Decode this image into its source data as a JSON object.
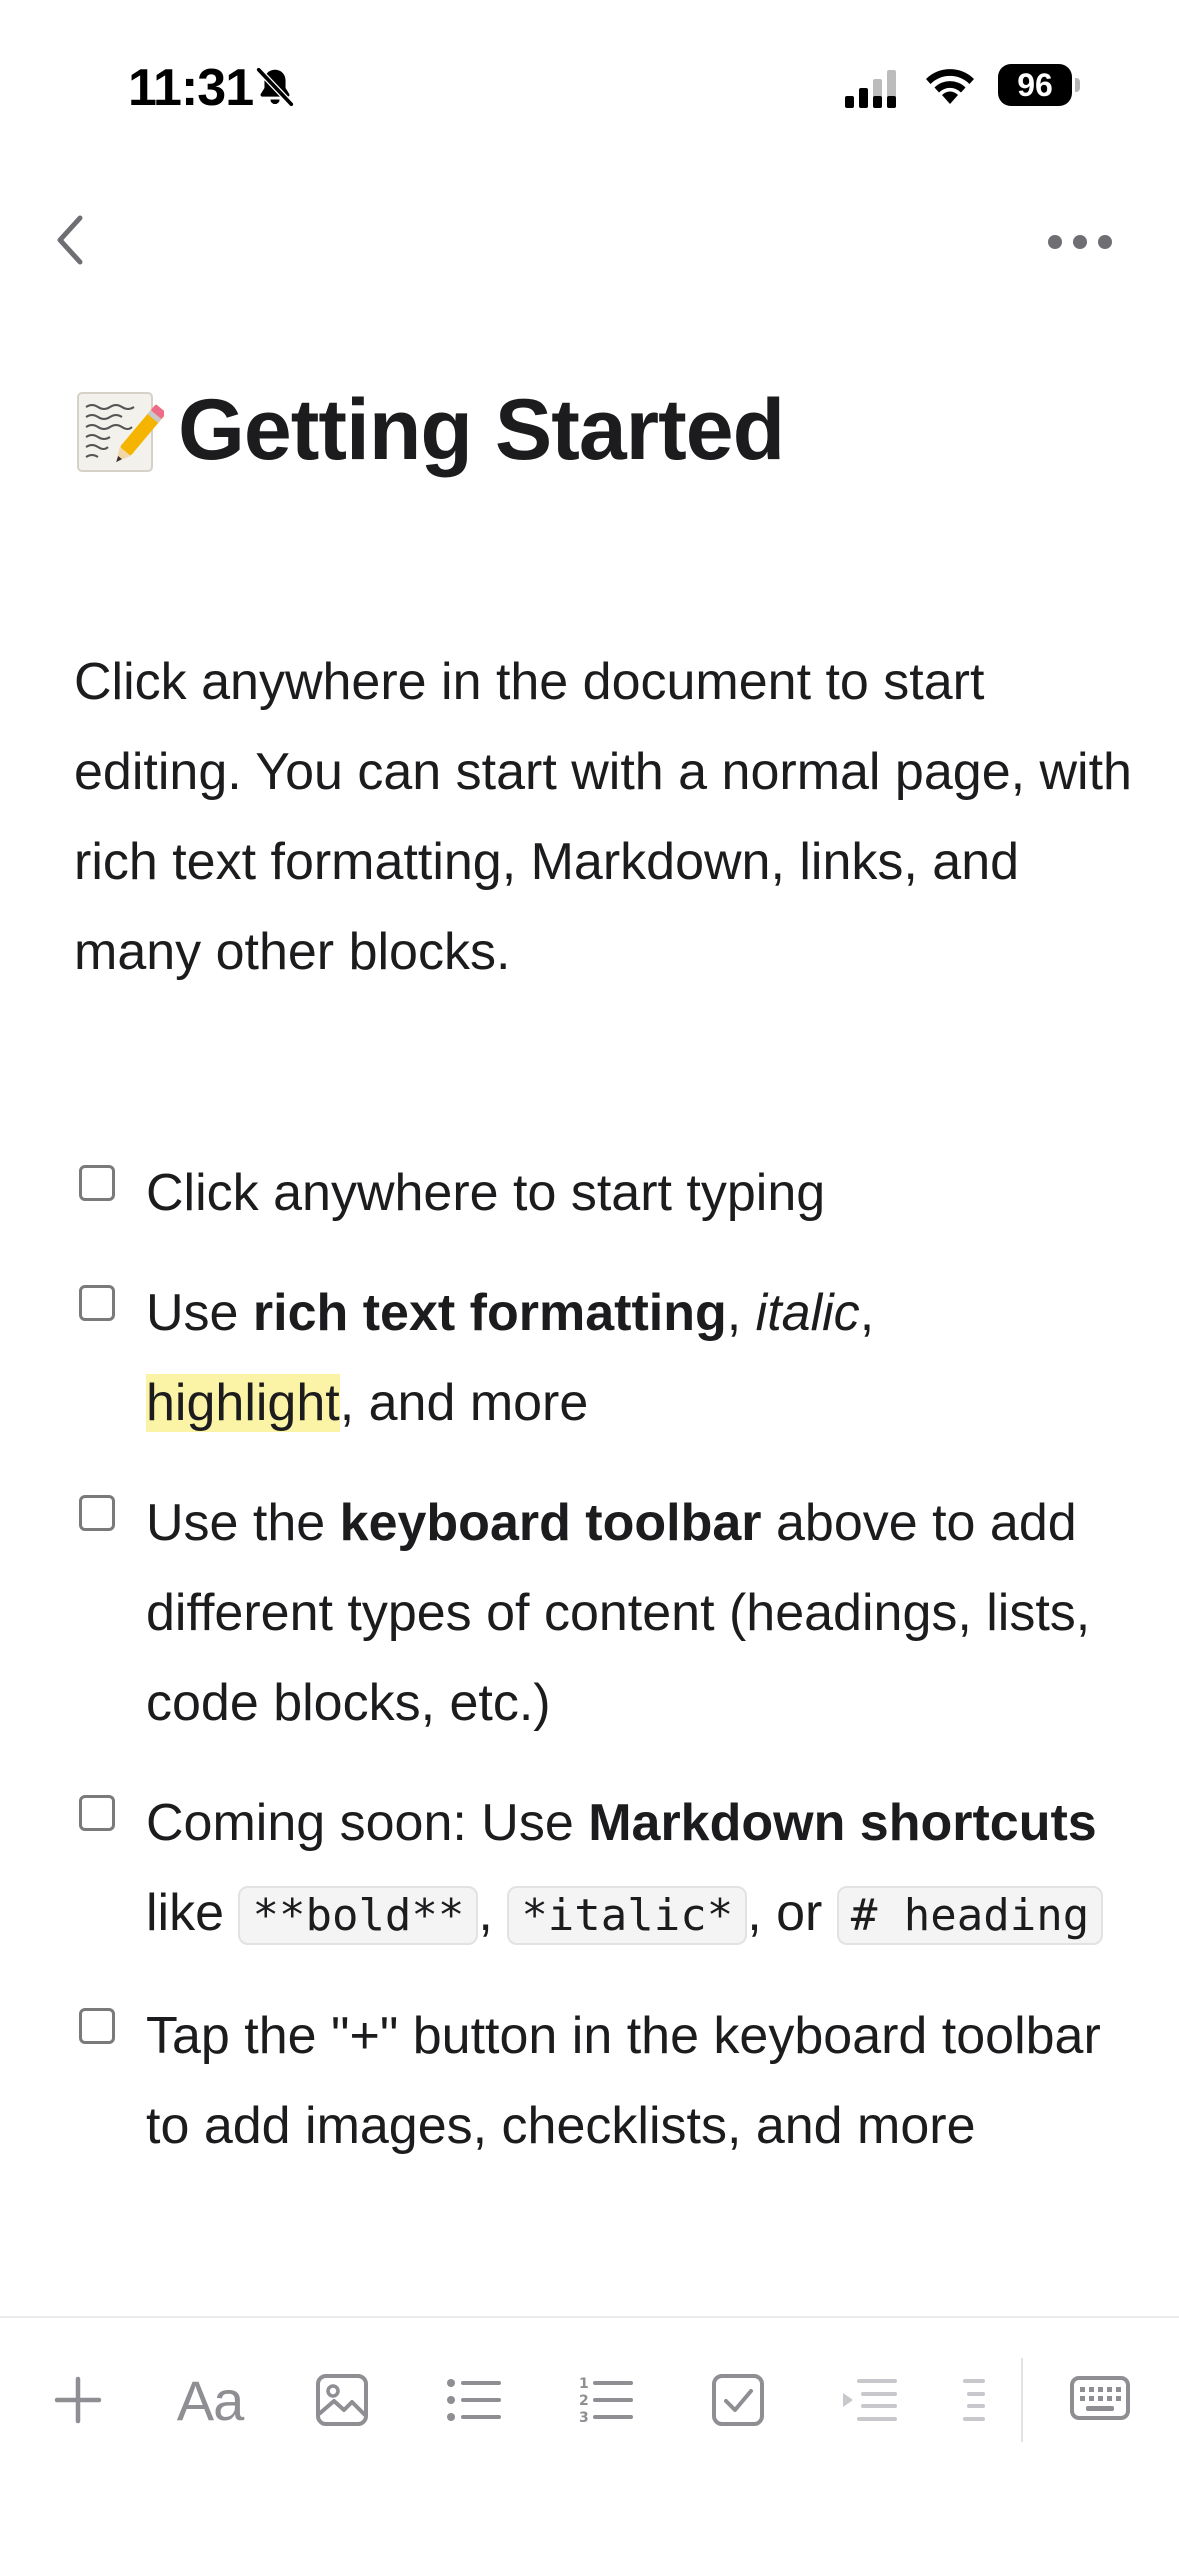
{
  "status_bar": {
    "time": "11:31",
    "battery_level": "96",
    "icons": [
      "bell-slash-icon",
      "signal-icon",
      "wifi-icon",
      "battery-icon"
    ]
  },
  "nav": {
    "back_icon": "chevron-left-icon",
    "more_icon": "ellipsis-icon"
  },
  "document": {
    "title_icon": "memo-icon",
    "title": "Getting Started",
    "intro": "Click anywhere in the document to start editing. You can start with a normal page, with rich text formatting, Markdown, links, and many other blocks.",
    "checklist": [
      {
        "checked": false,
        "text": "Click anywhere to start typing"
      },
      {
        "checked": false,
        "pre": "Use ",
        "bold": "rich text formatting",
        "sep1": ", ",
        "italic": "italic",
        "sep2": ", ",
        "highlight": "highlight",
        "post": ", and more"
      },
      {
        "checked": false,
        "pre": "Use the ",
        "bold": "keyboard toolbar",
        "post": " above to add different types of content (headings, lists, code blocks, etc.)"
      },
      {
        "checked": false,
        "pre": "Coming soon: Use ",
        "bold": "Markdown shortcuts",
        "mid": " like ",
        "code1": "**bold**",
        "sep1": ", ",
        "code2": "*italic*",
        "sep2": ", or ",
        "code3": "# heading"
      },
      {
        "checked": false,
        "text": "Tap the \"+\" button in the keyboard toolbar to add images, checklists, and more"
      }
    ]
  },
  "toolbar": {
    "text_style_label": "Aa",
    "items": [
      "plus-icon",
      "text-style-icon",
      "image-icon",
      "bulleted-list-icon",
      "numbered-list-icon",
      "checkbox-icon",
      "indent-icon",
      "outdent-icon",
      "keyboard-icon"
    ]
  },
  "colors": {
    "text": "#1c1c1e",
    "highlight": "#fbf3a6",
    "icon_gray": "#8e8e93",
    "checkbox_border": "#7a7a7a"
  }
}
